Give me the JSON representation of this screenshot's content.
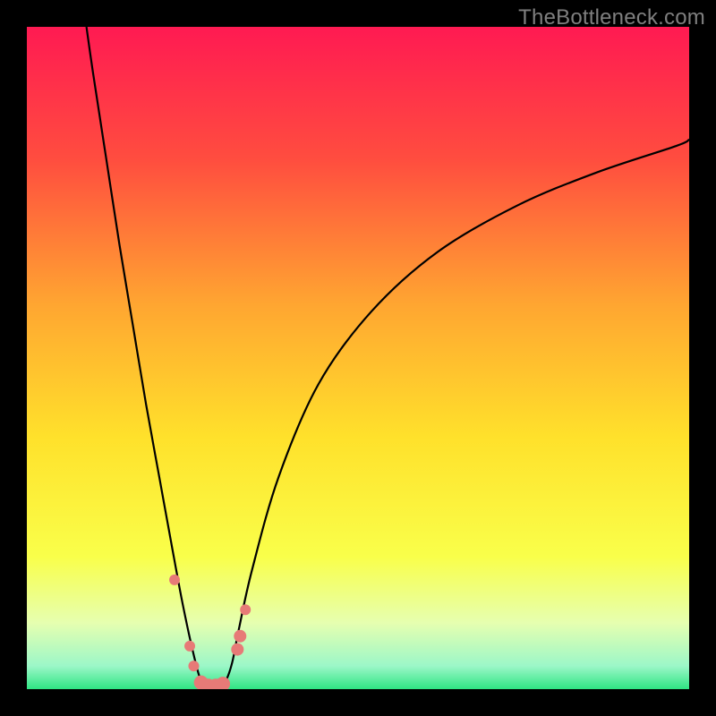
{
  "watermark": "TheBottleneck.com",
  "chart_data": {
    "type": "line",
    "title": "",
    "xlabel": "",
    "ylabel": "",
    "xlim": [
      0,
      100
    ],
    "ylim": [
      0,
      100
    ],
    "background_gradient": {
      "stops": [
        {
          "pos": 0.0,
          "color": "#ff1a52"
        },
        {
          "pos": 0.2,
          "color": "#ff4d3f"
        },
        {
          "pos": 0.42,
          "color": "#ffa631"
        },
        {
          "pos": 0.62,
          "color": "#ffe12b"
        },
        {
          "pos": 0.8,
          "color": "#f9ff4a"
        },
        {
          "pos": 0.9,
          "color": "#e6ffb0"
        },
        {
          "pos": 0.965,
          "color": "#9cf7c8"
        },
        {
          "pos": 1.0,
          "color": "#2fe583"
        }
      ]
    },
    "series": [
      {
        "name": "bottleneck-curve",
        "color": "#000000",
        "x": [
          9,
          10,
          12,
          14,
          16,
          18,
          20,
          22,
          23.5,
          25,
          26.2,
          27.3,
          28,
          29,
          30,
          31,
          32,
          34,
          38,
          44,
          52,
          62,
          74,
          86,
          98,
          100
        ],
        "y": [
          100,
          93,
          80,
          67,
          55,
          43,
          32,
          21,
          13,
          6,
          1.5,
          0.4,
          0.4,
          0.5,
          1.2,
          4,
          9,
          18,
          32,
          46,
          57,
          66,
          73,
          78,
          82,
          83
        ]
      }
    ],
    "markers": {
      "name": "highlighted-points",
      "color": "#e77a77",
      "points": [
        {
          "x": 22.3,
          "y": 16.5,
          "r": 6
        },
        {
          "x": 24.6,
          "y": 6.5,
          "r": 6
        },
        {
          "x": 25.2,
          "y": 3.5,
          "r": 6
        },
        {
          "x": 26.3,
          "y": 1.0,
          "r": 8
        },
        {
          "x": 27.4,
          "y": 0.5,
          "r": 8
        },
        {
          "x": 28.5,
          "y": 0.5,
          "r": 8
        },
        {
          "x": 29.6,
          "y": 0.8,
          "r": 8
        },
        {
          "x": 31.8,
          "y": 6.0,
          "r": 7
        },
        {
          "x": 32.2,
          "y": 8.0,
          "r": 7
        },
        {
          "x": 33.0,
          "y": 12.0,
          "r": 6
        }
      ]
    }
  }
}
